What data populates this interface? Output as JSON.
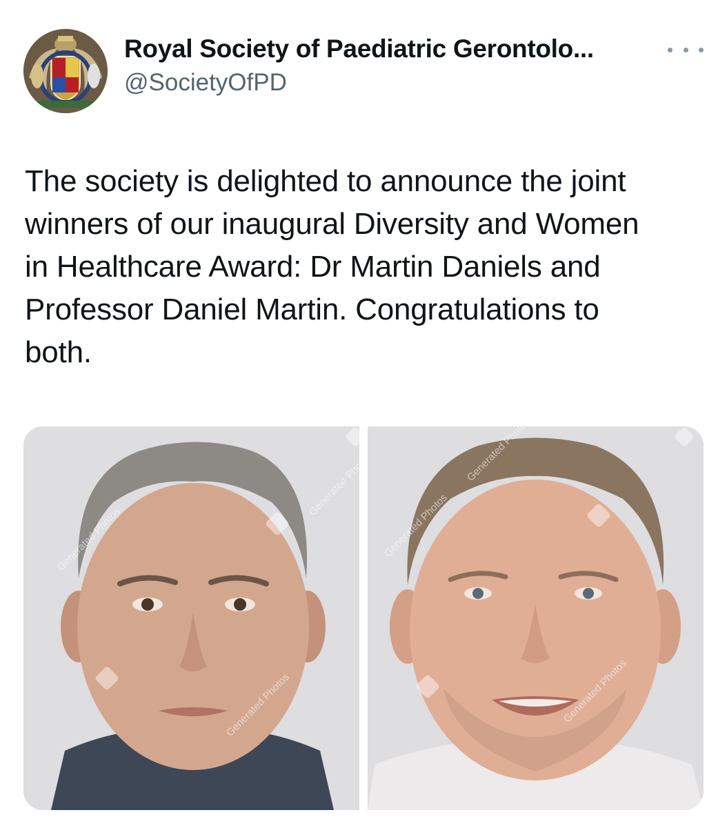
{
  "author": {
    "display_name": "Royal Society of Paediatric Gerontolo...",
    "handle": "@SocietyOfPD",
    "avatar_icon": "royal-coat-of-arms-crest-icon"
  },
  "more_icon": "more-options-ellipsis-icon",
  "tweet": {
    "lines": [
      "The society is delighted to announce the joint",
      "winners of our inaugural Diversity and Women",
      "in Healthcare Award: Dr Martin Daniels and",
      "Professor Daniel Martin. Congratulations to",
      "both."
    ]
  },
  "media": {
    "photos": [
      {
        "watermarks": [
          "Generated Photos",
          "Generated Photos",
          "Generated Photos"
        ]
      },
      {
        "watermarks": [
          "Generated Photos",
          "Generated Photos",
          "Generated Photos"
        ]
      }
    ]
  },
  "colors": {
    "text": "#0f1419",
    "secondary_text": "#536471",
    "background": "#ffffff",
    "photo_background": "#dcdcdf"
  }
}
